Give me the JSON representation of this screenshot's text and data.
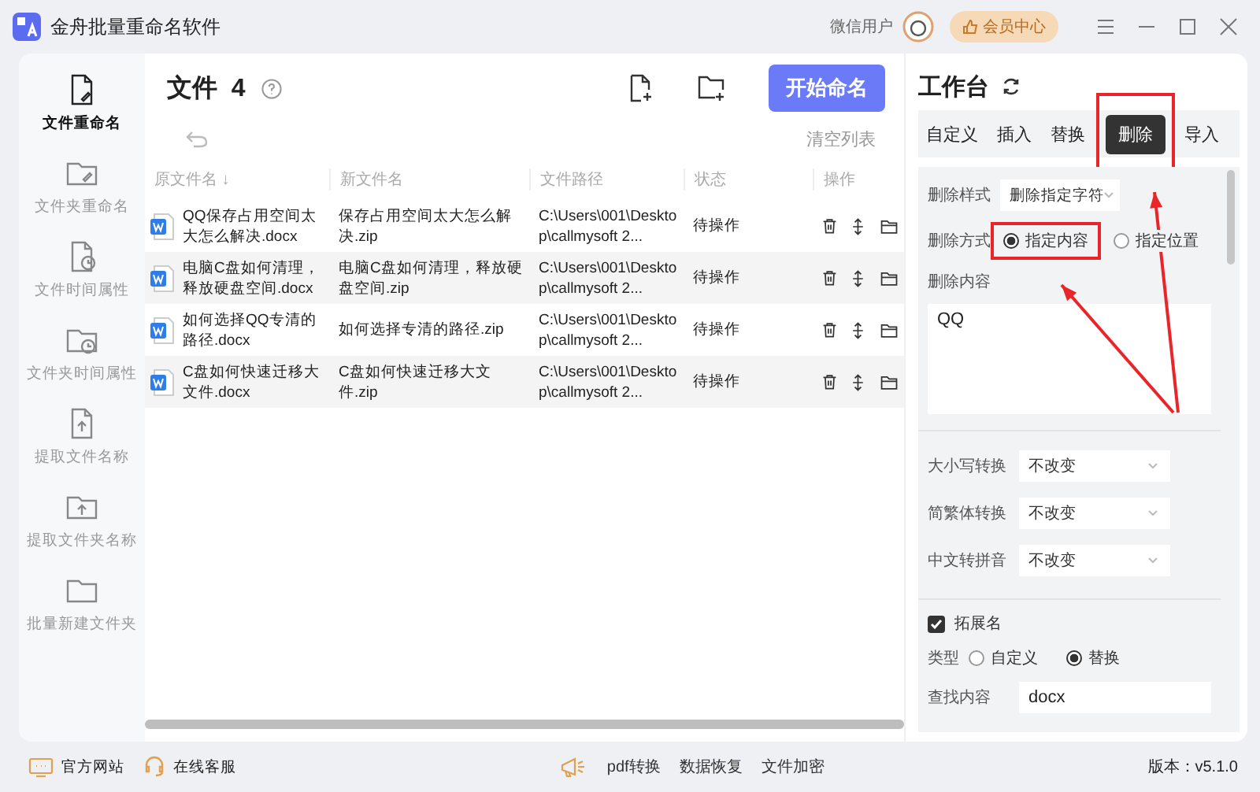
{
  "window": {
    "title": "金舟批量重命名软件",
    "user": "微信用户",
    "member_button": "会员中心"
  },
  "sidebar": {
    "items": [
      {
        "label": "文件重命名",
        "selected": true,
        "kind": "file"
      },
      {
        "label": "文件夹重命名",
        "selected": false,
        "kind": "folder"
      },
      {
        "label": "文件时间属性",
        "selected": false,
        "kind": "file-clock"
      },
      {
        "label": "文件夹时间属性",
        "selected": false,
        "kind": "folder-clock"
      },
      {
        "label": "提取文件名称",
        "selected": false,
        "kind": "file-up"
      },
      {
        "label": "提取文件夹名称",
        "selected": false,
        "kind": "folder-up"
      },
      {
        "label": "批量新建文件夹",
        "selected": false,
        "kind": "folders"
      }
    ]
  },
  "files": {
    "title": "文件",
    "count": "4",
    "start_button": "开始命名",
    "clear_button": "清空列表",
    "columns": [
      "原文件名 ↓",
      "新文件名",
      "文件路径",
      "状态",
      "操作"
    ],
    "rows": [
      {
        "original": "QQ保存占用空间太大怎么解决.docx",
        "new": "保存占用空间太大怎么解决.zip",
        "path": "C:\\Users\\001\\Desktop\\callmysoft 2...",
        "status": "待操作"
      },
      {
        "original": "电脑C盘如何清理，释放硬盘空间.docx",
        "new": "电脑C盘如何清理，释放硬盘空间.zip",
        "path": "C:\\Users\\001\\Desktop\\callmysoft 2...",
        "status": "待操作"
      },
      {
        "original": "如何选择QQ专清的路径.docx",
        "new": "如何选择专清的路径.zip",
        "path": "C:\\Users\\001\\Desktop\\callmysoft 2...",
        "status": "待操作"
      },
      {
        "original": "C盘如何快速迁移大文件.docx",
        "new": "C盘如何快速迁移大文件.zip",
        "path": "C:\\Users\\001\\Desktop\\callmysoft 2...",
        "status": "待操作"
      }
    ]
  },
  "workbench": {
    "title": "工作台",
    "tabs": [
      {
        "label": "自定义",
        "selected": false,
        "highlighted": false
      },
      {
        "label": "插入",
        "selected": false,
        "highlighted": false
      },
      {
        "label": "替换",
        "selected": false,
        "highlighted": false
      },
      {
        "label": "删除",
        "selected": true,
        "highlighted": true
      },
      {
        "label": "导入",
        "selected": false,
        "highlighted": false
      }
    ],
    "delete_style": {
      "label": "删除样式",
      "value": "删除指定字符"
    },
    "delete_mode": {
      "label": "删除方式",
      "options": [
        {
          "label": "指定内容",
          "selected": true,
          "highlighted": true
        },
        {
          "label": "指定位置",
          "selected": false,
          "highlighted": false
        }
      ]
    },
    "delete_content": {
      "label": "删除内容",
      "value": "QQ"
    },
    "conversions": [
      {
        "label": "大小写转换",
        "value": "不改变"
      },
      {
        "label": "简繁体转换",
        "value": "不改变"
      },
      {
        "label": "中文转拼音",
        "value": "不改变"
      }
    ],
    "extension": {
      "label": "拓展名",
      "checked": true,
      "type_label": "类型",
      "type_options": [
        {
          "label": "自定义",
          "selected": false
        },
        {
          "label": "替换",
          "selected": true
        }
      ],
      "find_label": "查找内容",
      "find_value": "docx"
    }
  },
  "footer": {
    "links": [
      {
        "label": "官方网站",
        "kind": "site"
      },
      {
        "label": "在线客服",
        "kind": "support"
      }
    ],
    "tools": [
      "pdf转换",
      "数据恢复",
      "文件加密"
    ],
    "version": "版本：v5.1.0"
  }
}
